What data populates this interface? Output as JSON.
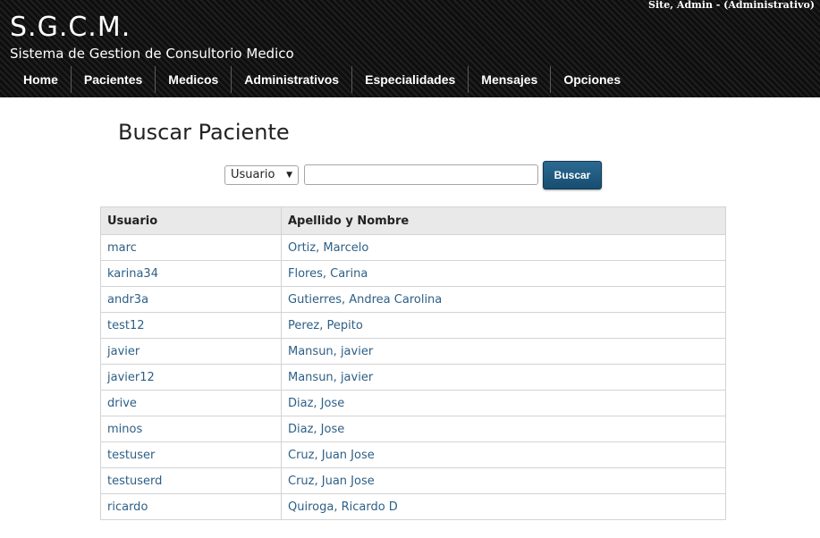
{
  "header": {
    "logo": "S.G.C.M.",
    "subtitle": "Sistema de Gestion de Consultorio Medico",
    "user_info": "Site, Admin - (Administrativo)"
  },
  "nav": {
    "items": [
      {
        "label": "Home"
      },
      {
        "label": "Pacientes"
      },
      {
        "label": "Medicos"
      },
      {
        "label": "Administrativos"
      },
      {
        "label": "Especialidades"
      },
      {
        "label": "Mensajes"
      },
      {
        "label": "Opciones"
      }
    ]
  },
  "page": {
    "title": "Buscar Paciente"
  },
  "search": {
    "field_selected": "Usuario",
    "input_value": "",
    "input_placeholder": "",
    "button_label": "Buscar"
  },
  "table": {
    "headers": [
      "Usuario",
      "Apellido y Nombre"
    ],
    "rows": [
      {
        "usuario": "marc",
        "nombre": "Ortiz, Marcelo"
      },
      {
        "usuario": "karina34",
        "nombre": "Flores, Carina"
      },
      {
        "usuario": "andr3a",
        "nombre": "Gutierres, Andrea Carolina"
      },
      {
        "usuario": "test12",
        "nombre": "Perez, Pepito"
      },
      {
        "usuario": "javier",
        "nombre": "Mansun, javier"
      },
      {
        "usuario": "javier12",
        "nombre": "Mansun, javier"
      },
      {
        "usuario": "drive",
        "nombre": "Diaz, Jose"
      },
      {
        "usuario": "minos",
        "nombre": "Diaz, Jose"
      },
      {
        "usuario": "testuser",
        "nombre": "Cruz, Juan Jose"
      },
      {
        "usuario": "testuserd",
        "nombre": "Cruz, Juan Jose"
      },
      {
        "usuario": "ricardo",
        "nombre": "Quiroga, Ricardo D"
      }
    ]
  },
  "icons": {
    "select_arrow": "chevron-down-icon"
  },
  "colors": {
    "header_bg": "#161616",
    "link": "#2d5f86",
    "button": "#1f5a80",
    "table_header_bg": "#e9e9e9"
  }
}
